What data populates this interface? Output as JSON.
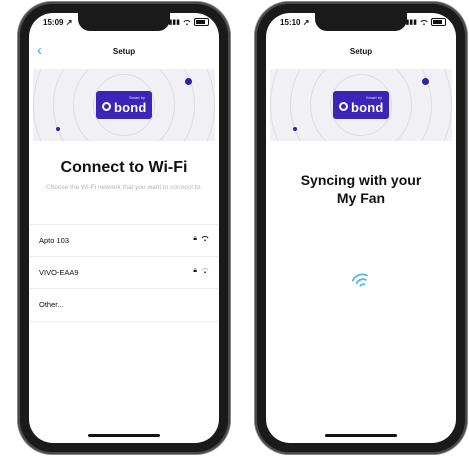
{
  "colors": {
    "accent": "#2aa6e0",
    "brand": "#3b25b8",
    "dot": "#2b24a6",
    "banner_bg": "#f0f0f5"
  },
  "left_screen": {
    "status": {
      "time": "15:09",
      "arrow": "↗"
    },
    "nav": {
      "back_icon": "chevron-left-icon",
      "title": "Setup"
    },
    "logo": {
      "small_text": "Smart by",
      "word": "bond"
    },
    "heading": "Connect to Wi-Fi",
    "subtitle": "Choose the Wi-Fi network that you want to connect to.",
    "networks": [
      {
        "name": "Apto 103",
        "icons": [
          "lock-icon",
          "wifi-icon"
        ]
      },
      {
        "name": "VIVO-EAA9",
        "icons": [
          "lock-icon",
          "wifi-icon"
        ]
      },
      {
        "name": "Other...",
        "icons": []
      }
    ]
  },
  "right_screen": {
    "status": {
      "time": "15:10",
      "arrow": "↗"
    },
    "nav": {
      "title": "Setup"
    },
    "logo": {
      "small_text": "Smart by",
      "word": "bond"
    },
    "heading_line1": "Syncing with your",
    "heading_line2": "My Fan",
    "sync_icon": "wifi-syncing-icon"
  }
}
